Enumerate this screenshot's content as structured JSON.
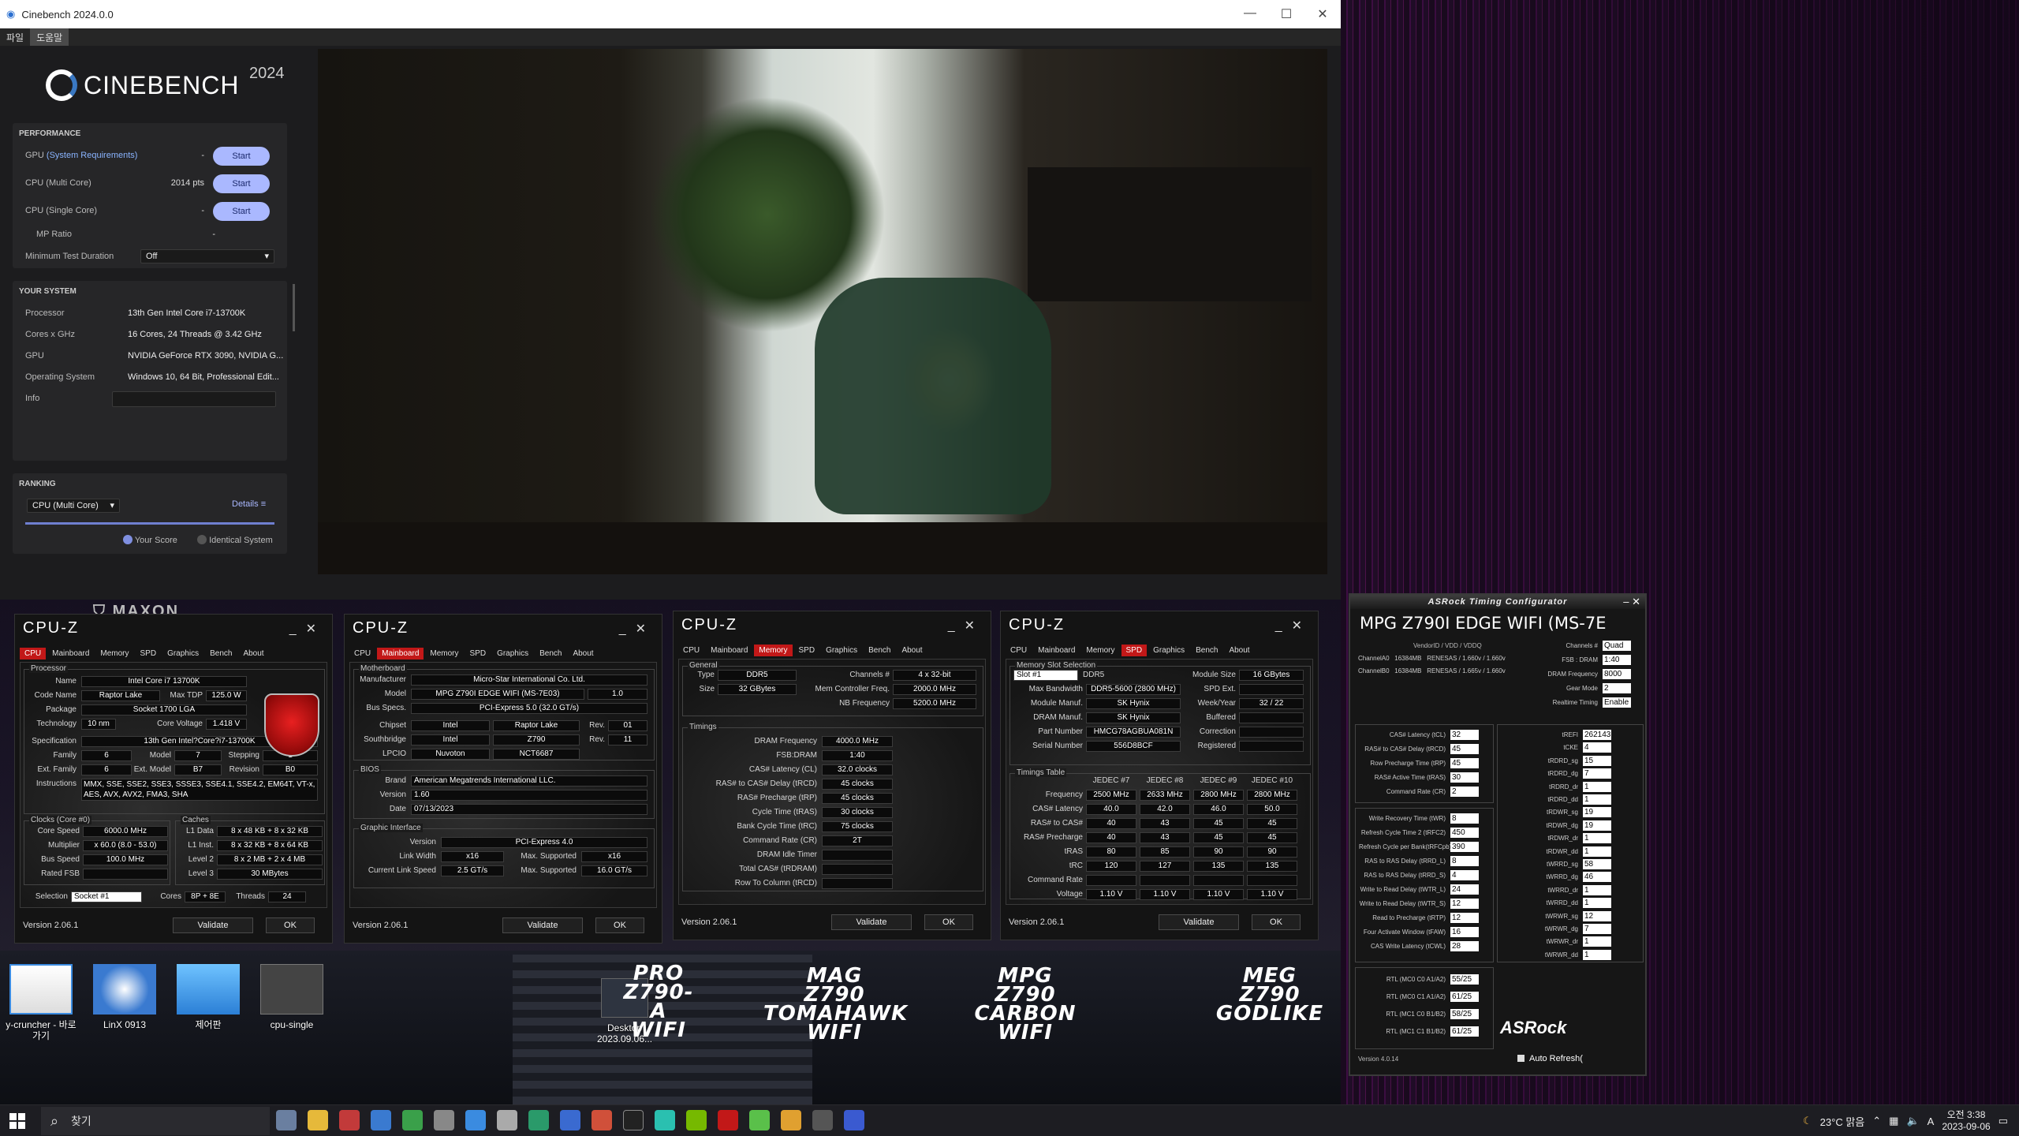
{
  "cinebench": {
    "window_title": "Cinebench 2024.0.0",
    "menu": [
      "파일",
      "도움말"
    ],
    "brand": "CINEBENCH",
    "year": "2024",
    "performance": {
      "heading": "PERFORMANCE",
      "rows": [
        {
          "label": "GPU",
          "label_link": "(System Requirements)",
          "value": "-",
          "button": "Start"
        },
        {
          "label": "CPU (Multi Core)",
          "value": "2014 pts",
          "button": "Start"
        },
        {
          "label": "CPU (Single Core)",
          "value": "-",
          "button": "Start"
        },
        {
          "label": "MP Ratio",
          "value": "-"
        }
      ],
      "min_duration_label": "Minimum Test Duration",
      "min_duration_value": "Off"
    },
    "system": {
      "heading": "YOUR SYSTEM",
      "rows": [
        {
          "label": "Processor",
          "value": "13th Gen Intel Core i7-13700K"
        },
        {
          "label": "Cores x GHz",
          "value": "16 Cores, 24 Threads @ 3.42 GHz"
        },
        {
          "label": "GPU",
          "value": "NVIDIA GeForce RTX 3090, NVIDIA G..."
        },
        {
          "label": "Operating System",
          "value": "Windows 10, 64 Bit, Professional Edit..."
        },
        {
          "label": "Info",
          "value": ""
        }
      ]
    },
    "ranking": {
      "heading": "RANKING",
      "select": "CPU (Multi Core)",
      "details": "Details",
      "your_score": "Your Score",
      "identical": "Identical System"
    },
    "maxon": "MAXON"
  },
  "cpuz_cpu": {
    "tabs": [
      "CPU",
      "Mainboard",
      "Memory",
      "SPD",
      "Graphics",
      "Bench",
      "About"
    ],
    "processor_legend": "Processor",
    "name": "Intel Core i7 13700K",
    "code_name": "Raptor Lake",
    "max_tdp": "125.0 W",
    "package": "Socket 1700 LGA",
    "technology": "10 nm",
    "core_voltage": "1.418 V",
    "specification": "13th Gen Intel?Core?i7-13700K",
    "family": "6",
    "model": "7",
    "stepping": "1",
    "ext_family": "6",
    "ext_model": "B7",
    "revision": "B0",
    "instructions": "MMX, SSE, SSE2, SSE3, SSSE3, SSE4.1, SSE4.2, EM64T, VT-x, AES, AVX, AVX2, FMA3, SHA",
    "clocks_legend": "Clocks (Core #0)",
    "caches_legend": "Caches",
    "core_speed": "6000.0 MHz",
    "multiplier": "x 60.0 (8.0 - 53.0)",
    "bus_speed": "100.0 MHz",
    "rated_fsb": "",
    "l1_data": "8 x 48 KB + 8 x 32 KB",
    "l1_inst": "8 x 32 KB + 8 x 64 KB",
    "level2": "8 x 2 MB + 2 x 4 MB",
    "level3": "30 MBytes",
    "selection": "Socket #1",
    "cores": "8P + 8E",
    "threads": "24",
    "labels": {
      "name": "Name",
      "code": "Code Name",
      "tdp": "Max TDP",
      "pkg": "Package",
      "tech": "Technology",
      "cv": "Core Voltage",
      "spec": "Specification",
      "fam": "Family",
      "mod": "Model",
      "step": "Stepping",
      "efam": "Ext. Family",
      "emod": "Ext. Model",
      "rev": "Revision",
      "inst": "Instructions",
      "cs": "Core Speed",
      "mult": "Multiplier",
      "bus": "Bus Speed",
      "fsb": "Rated FSB",
      "l1d": "L1 Data",
      "l1i": "L1 Inst.",
      "l2": "Level 2",
      "l3": "Level 3",
      "sel": "Selection",
      "cores": "Cores",
      "thr": "Threads"
    }
  },
  "cpuz_mb": {
    "legend": "Motherboard",
    "manufacturer": "Micro-Star International Co. Ltd.",
    "model": "MPG Z790I EDGE WIFI (MS-7E03)",
    "model_rev": "1.0",
    "bus_specs": "PCI-Express 5.0 (32.0 GT/s)",
    "chipset": "Intel",
    "chipset_v": "Raptor Lake",
    "chipset_rev": "01",
    "southbridge": "Intel",
    "southbridge_v": "Z790",
    "southbridge_rev": "11",
    "lpcio": "Nuvoton",
    "lpcio_v": "NCT6687",
    "bios_legend": "BIOS",
    "brand": "American Megatrends International LLC.",
    "version": "1.60",
    "date": "07/13/2023",
    "gi_legend": "Graphic Interface",
    "gi_version": "PCI-Express 4.0",
    "link_width": "x16",
    "max_width": "x16",
    "link_speed": "2.5 GT/s",
    "max_speed": "16.0 GT/s",
    "labels": {
      "man": "Manufacturer",
      "model": "Model",
      "bus": "Bus Specs.",
      "chip": "Chipset",
      "sb": "Southbridge",
      "lpc": "LPCIO",
      "rev": "Rev.",
      "brand": "Brand",
      "ver": "Version",
      "date": "Date",
      "giv": "Version",
      "lw": "Link Width",
      "ms": "Max. Supported",
      "ls": "Current Link Speed"
    }
  },
  "cpuz_mem": {
    "general_legend": "General",
    "type": "DDR5",
    "size": "32 GBytes",
    "channels": "4 x 32-bit",
    "mem_ctrl": "2000.0 MHz",
    "nb_freq": "5200.0 MHz",
    "timings_legend": "Timings",
    "dram_freq": "4000.0 MHz",
    "fsb_dram": "1:40",
    "cl": "32.0 clocks",
    "trcd": "45 clocks",
    "trp": "45 clocks",
    "tras": "30 clocks",
    "trc": "75 clocks",
    "cr": "2T",
    "labels": {
      "type": "Type",
      "size": "Size",
      "ch": "Channels #",
      "mc": "Mem Controller Freq.",
      "nb": "NB Frequency",
      "df": "DRAM Frequency",
      "fsb": "FSB:DRAM",
      "cl": "CAS# Latency (CL)",
      "rcd": "RAS# to CAS# Delay (tRCD)",
      "rp": "RAS# Precharge (tRP)",
      "ras": "Cycle Time (tRAS)",
      "rc": "Bank Cycle Time (tRC)",
      "cr": "Command Rate (CR)",
      "idle": "DRAM Idle Timer",
      "trdram": "Total CAS# (tRDRAM)",
      "rtc": "Row To Column (tRCD)"
    }
  },
  "cpuz_spd": {
    "legend": "Memory Slot Selection",
    "slot": "Slot #1",
    "type": "DDR5",
    "module_size": "16 GBytes",
    "max_bw": "DDR5-5600 (2800 MHz)",
    "spd_ext": "",
    "manuf": "SK Hynix",
    "week_year": "32 / 22",
    "dram_manuf": "SK Hynix",
    "buffered": "",
    "part": "HMCG78AGBUA081N",
    "correction": "",
    "serial": "556D8BCF",
    "registered": "",
    "tt_legend": "Timings Table",
    "jedec_heads": [
      "JEDEC #7",
      "JEDEC #8",
      "JEDEC #9",
      "JEDEC #10"
    ],
    "rows": [
      {
        "k": "Frequency",
        "v": [
          "2500 MHz",
          "2633 MHz",
          "2800 MHz",
          "2800 MHz"
        ]
      },
      {
        "k": "CAS# Latency",
        "v": [
          "40.0",
          "42.0",
          "46.0",
          "50.0"
        ]
      },
      {
        "k": "RAS# to CAS#",
        "v": [
          "40",
          "43",
          "45",
          "45"
        ]
      },
      {
        "k": "RAS# Precharge",
        "v": [
          "40",
          "43",
          "45",
          "45"
        ]
      },
      {
        "k": "tRAS",
        "v": [
          "80",
          "85",
          "90",
          "90"
        ]
      },
      {
        "k": "tRC",
        "v": [
          "120",
          "127",
          "135",
          "135"
        ]
      },
      {
        "k": "Command Rate",
        "v": [
          "",
          "",
          "",
          ""
        ]
      },
      {
        "k": "Voltage",
        "v": [
          "1.10 V",
          "1.10 V",
          "1.10 V",
          "1.10 V"
        ]
      }
    ],
    "labels": {
      "ms": "Module Size",
      "mb": "Max Bandwidth",
      "se": "SPD Ext.",
      "mm": "Module Manuf.",
      "wy": "Week/Year",
      "dm": "DRAM Manuf.",
      "buf": "Buffered",
      "pn": "Part Number",
      "cor": "Correction",
      "sn": "Serial Number",
      "reg": "Registered"
    }
  },
  "cpuz_common": {
    "brand": "CPU-Z",
    "version": "Version 2.06.1",
    "validate": "Validate",
    "ok": "OK"
  },
  "asrock": {
    "title": "ASRock Timing Configurator",
    "board": "MPG Z790I EDGE WIFI (MS-7E",
    "vendor_head": "VendorID / VDD / VDDQ",
    "channels_info": [
      {
        "ch": "ChannelA0",
        "size": "16384MB",
        "vendor": "RENESAS / 1.660v / 1.660v"
      },
      {
        "ch": "ChannelB0",
        "size": "16384MB",
        "vendor": "RENESAS / 1.665v / 1.660v"
      }
    ],
    "top_right": [
      {
        "k": "Channels #",
        "v": "Quad"
      },
      {
        "k": "FSB : DRAM",
        "v": "1:40"
      },
      {
        "k": "DRAM Frequency",
        "v": "8000"
      },
      {
        "k": "Gear Mode",
        "v": "2"
      },
      {
        "k": "Realtime Timing",
        "v": "Enable"
      }
    ],
    "primary": [
      {
        "k": "CAS# Latency (tCL)",
        "v": "32"
      },
      {
        "k": "RAS# to CAS# Delay (tRCD)",
        "v": "45"
      },
      {
        "k": "Row Precharge Time (tRP)",
        "v": "45"
      },
      {
        "k": "RAS# Active Time (tRAS)",
        "v": "30"
      },
      {
        "k": "Command Rate (CR)",
        "v": "2"
      }
    ],
    "secondary": [
      {
        "k": "Write Recovery Time (tWR)",
        "v": "8"
      },
      {
        "k": "Refresh Cycle Time 2 (tRFC2)",
        "v": "450"
      },
      {
        "k": "Refresh Cycle per Bank(tRFCpb)",
        "v": "390"
      },
      {
        "k": "RAS to RAS Delay (tRRD_L)",
        "v": "8"
      },
      {
        "k": "RAS to RAS Delay (tRRD_S)",
        "v": "4"
      },
      {
        "k": "Write to Read Delay (tWTR_L)",
        "v": "24"
      },
      {
        "k": "Write to Read Delay (tWTR_S)",
        "v": "12"
      },
      {
        "k": "Read to Precharge (tRTP)",
        "v": "12"
      },
      {
        "k": "Four Activate Window (tFAW)",
        "v": "16"
      },
      {
        "k": "CAS Write Latency (tCWL)",
        "v": "28"
      }
    ],
    "right_col": [
      {
        "k": "tREFI",
        "v": "262143"
      },
      {
        "k": "tCKE",
        "v": "4"
      },
      {
        "k": "tRDRD_sg",
        "v": "15"
      },
      {
        "k": "tRDRD_dg",
        "v": "7"
      },
      {
        "k": "tRDRD_dr",
        "v": "1"
      },
      {
        "k": "tRDRD_dd",
        "v": "1"
      },
      {
        "k": "tRDWR_sg",
        "v": "19"
      },
      {
        "k": "tRDWR_dg",
        "v": "19"
      },
      {
        "k": "tRDWR_dr",
        "v": "1"
      },
      {
        "k": "tRDWR_dd",
        "v": "1"
      },
      {
        "k": "tWRRD_sg",
        "v": "58"
      },
      {
        "k": "tWRRD_dg",
        "v": "46"
      },
      {
        "k": "tWRRD_dr",
        "v": "1"
      },
      {
        "k": "tWRRD_dd",
        "v": "1"
      },
      {
        "k": "tWRWR_sg",
        "v": "12"
      },
      {
        "k": "tWRWR_dg",
        "v": "7"
      },
      {
        "k": "tWRWR_dr",
        "v": "1"
      },
      {
        "k": "tWRWR_dd",
        "v": "1"
      }
    ],
    "rtl": [
      {
        "k": "RTL (MC0 C0 A1/A2)",
        "v": "55/25"
      },
      {
        "k": "RTL (MC0 C1 A1/A2)",
        "v": "61/25"
      },
      {
        "k": "RTL (MC1 C0 B1/B2)",
        "v": "58/25"
      },
      {
        "k": "RTL (MC1 C1 B1/B2)",
        "v": "61/25"
      }
    ],
    "logo": "ASRock",
    "version": "Version 4.0.14",
    "auto_refresh": "Auto Refresh("
  },
  "desktop": {
    "icons": [
      {
        "label": "y-cruncher - 바로 가기"
      },
      {
        "label": "LinX 0913"
      },
      {
        "label": "제어판"
      },
      {
        "label": "cpu-single"
      },
      {
        "label": "Desktop 2023.09.06..."
      }
    ],
    "boards": [
      {
        "l1": "PRO",
        "l2": "Z790-A",
        "l3": "WIFI"
      },
      {
        "l1": "MAG",
        "l2": "Z790",
        "l3": "TOMAHAWK",
        "l4": "WIFI"
      },
      {
        "l1": "MPG",
        "l2": "Z790",
        "l3": "CARBON",
        "l4": "WIFI"
      },
      {
        "l1": "MEG",
        "l2": "Z790",
        "l3": "GODLIKE"
      }
    ]
  },
  "taskbar": {
    "search": "찾기",
    "weather": "23°C 맑음",
    "time": "오전 3:38",
    "date": "2023-09-06"
  },
  "colors": {
    "accent_red": "#c21818",
    "cb_start": "#aab8ff",
    "cb_bg": "#1c1c1e"
  }
}
